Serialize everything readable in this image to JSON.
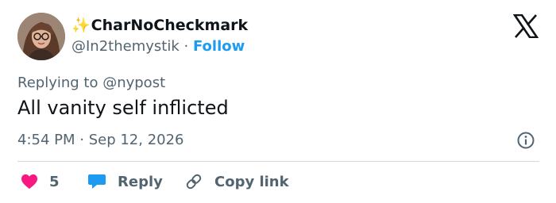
{
  "user": {
    "display_name": "CharNoCheckmark",
    "handle": "@In2themystik",
    "separator": "·",
    "follow_label": "Follow"
  },
  "reply_context": "Replying to @nypost",
  "tweet": {
    "text": "All vanity self inflicted",
    "timestamp": "4:54 PM · Sep 12, 2026"
  },
  "actions": {
    "likes_count": "5",
    "reply_label": "Reply",
    "copy_label": "Copy link"
  },
  "icons": {
    "sparkle": "sparkle-icon",
    "platform": "x-logo-icon",
    "info": "info-icon",
    "like": "heart-icon",
    "reply": "chat-bubble-icon",
    "copy": "link-icon"
  },
  "colors": {
    "like": "#f91880",
    "reply": "#1d9bf0",
    "follow": "#1d9bf0",
    "secondary_text": "#536471",
    "primary_text": "#0f1419"
  }
}
